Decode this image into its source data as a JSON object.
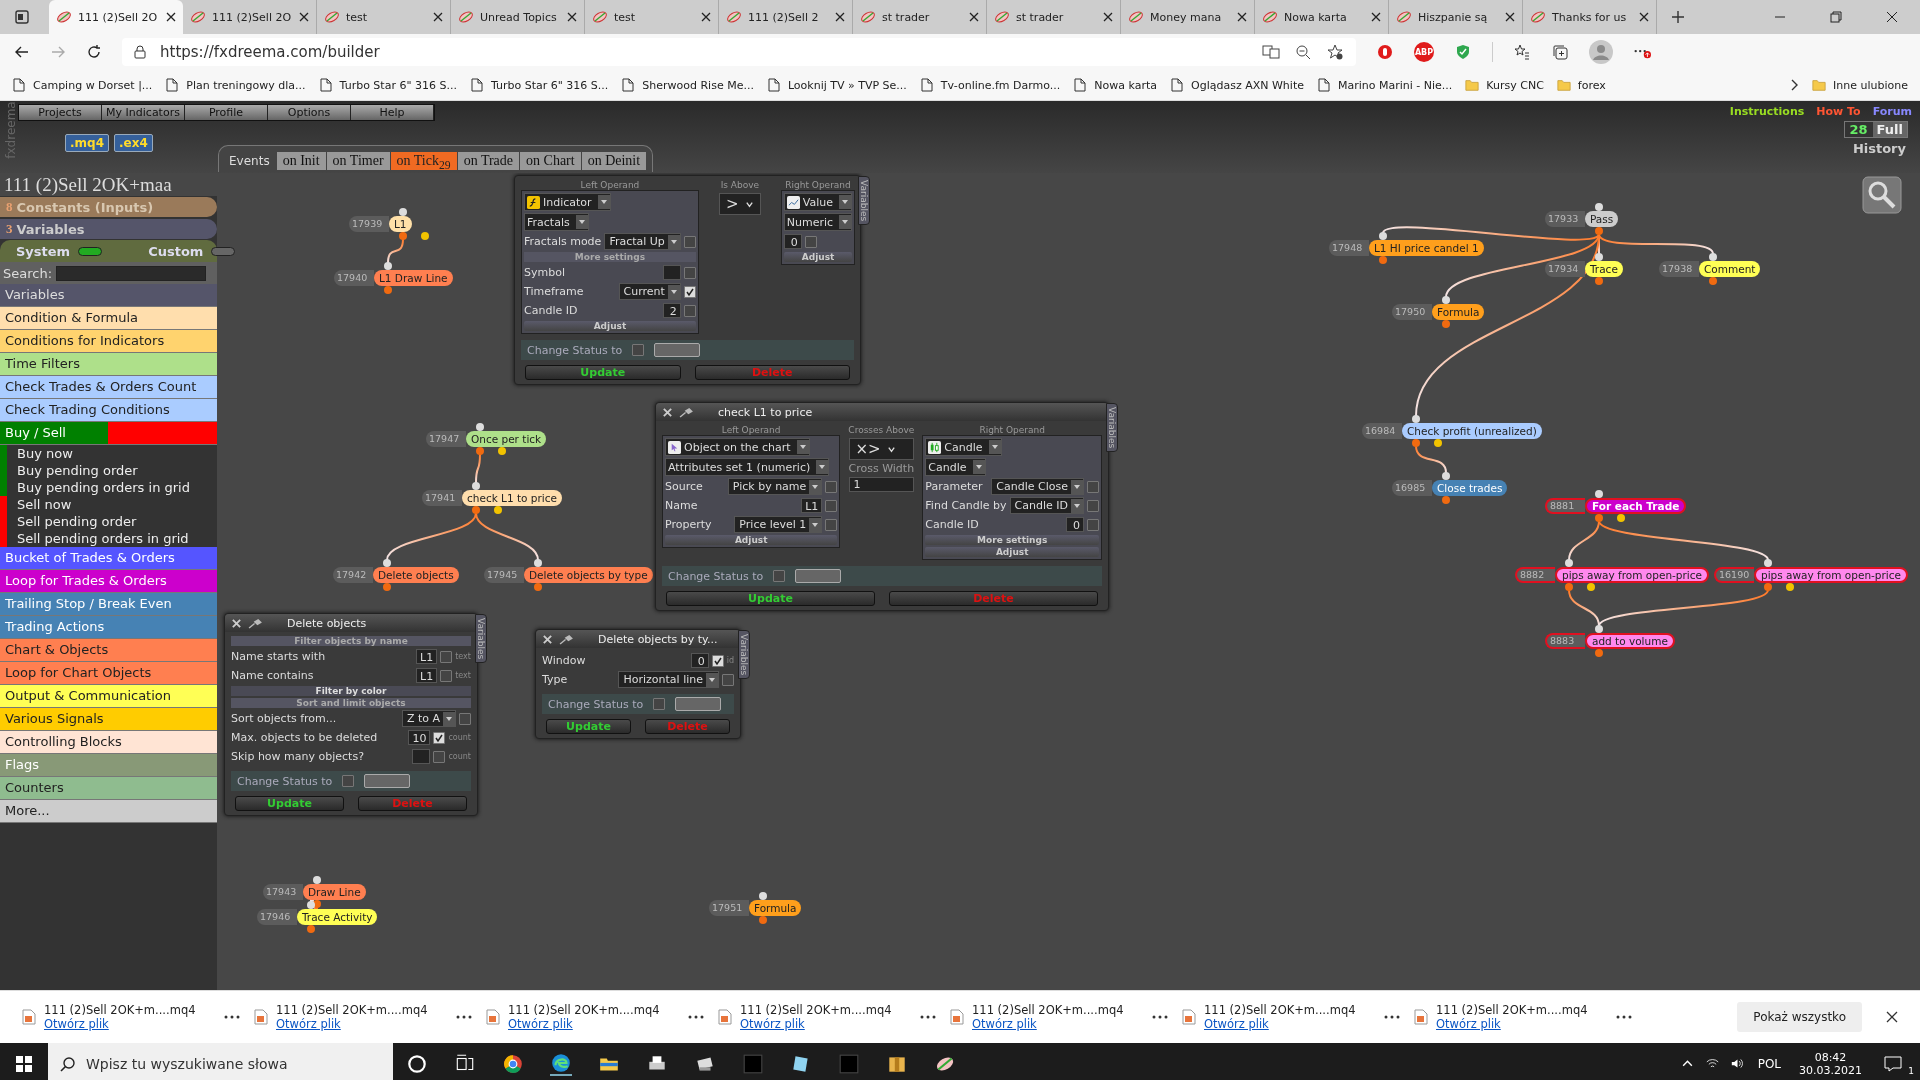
{
  "browser": {
    "tabs": [
      {
        "title": "111 (2)Sell 2O",
        "selected": true
      },
      {
        "title": "111 (2)Sell 2O",
        "selected": false
      },
      {
        "title": "test",
        "selected": false
      },
      {
        "title": "Unread Topics",
        "selected": false
      },
      {
        "title": "test",
        "selected": false
      },
      {
        "title": "111 (2)Sell 2",
        "selected": false
      },
      {
        "title": "st trader",
        "selected": false
      },
      {
        "title": "st trader",
        "selected": false
      },
      {
        "title": "Money mana",
        "selected": false
      },
      {
        "title": "Nowa karta",
        "selected": false
      },
      {
        "title": "Hiszpanie są",
        "selected": false
      },
      {
        "title": "Thanks for us",
        "selected": false
      }
    ],
    "address": "https://fxdreema.com/builder",
    "adblock_label": "ABP",
    "bookmarks": [
      {
        "label": "Camping w Dorset |...",
        "kind": "page"
      },
      {
        "label": "Plan treningowy dla...",
        "kind": "page"
      },
      {
        "label": "Turbo Star 6\" 316 S...",
        "kind": "page"
      },
      {
        "label": "Turbo Star 6\" 316 S...",
        "kind": "page"
      },
      {
        "label": "Sherwood Rise Me...",
        "kind": "page"
      },
      {
        "label": "Looknij TV » TVP Se...",
        "kind": "page"
      },
      {
        "label": "Tv-online.fm Darmo...",
        "kind": "page"
      },
      {
        "label": "Nowa karta",
        "kind": "page"
      },
      {
        "label": "Oglądasz AXN White",
        "kind": "page"
      },
      {
        "label": "Marino Marini - Nie...",
        "kind": "page"
      },
      {
        "label": "Kursy CNC",
        "kind": "folder"
      },
      {
        "label": "forex",
        "kind": "folder"
      }
    ],
    "other_bookmarks": "Inne ulubione"
  },
  "app": {
    "side_logo": "fxdreema",
    "menu": [
      "Projects",
      "My Indicators",
      "Profile",
      "Options",
      "Help"
    ],
    "exports": [
      ".mq4",
      ".ex4"
    ],
    "events_label": "Events",
    "event_tabs": [
      {
        "label": "on Init",
        "selected": false
      },
      {
        "label": "on Timer",
        "selected": false
      },
      {
        "label": "on Tick$_{29}$",
        "selected": true
      },
      {
        "label": "on Trade",
        "selected": false
      },
      {
        "label": "on Chart",
        "selected": false
      },
      {
        "label": "on Deinit",
        "selected": false
      }
    ],
    "help_links": [
      {
        "label": "Instructions",
        "color": "#99dd22"
      },
      {
        "label": "How To",
        "color": "#ff5533"
      },
      {
        "label": "Forum",
        "color": "#8888ff"
      }
    ],
    "counter": "28",
    "mode": "Full",
    "history": "History",
    "project_title": "111 (2)Sell 2OK+maa",
    "constants": {
      "count": "8",
      "label": "Constants (Inputs)"
    },
    "variables": {
      "count": "3",
      "label": "Variables"
    },
    "toggles": [
      {
        "label": "System",
        "on": true
      },
      {
        "label": "Custom",
        "on": false
      }
    ],
    "search_label": "Search:",
    "categories": [
      {
        "label": "Variables",
        "kind": "header",
        "color": "#55556a"
      },
      {
        "label": "Condition & Formula",
        "kind": "item",
        "color": "#ffdead"
      },
      {
        "label": "Conditions for Indicators",
        "kind": "item",
        "color": "#ffd36e"
      },
      {
        "label": "Time Filters",
        "kind": "item",
        "color": "#aee08a"
      },
      {
        "label": "Check Trades & Orders Count",
        "kind": "item",
        "color": "#aaccff"
      },
      {
        "label": "Check Trading Conditions",
        "kind": "item",
        "color": "#aaccff"
      },
      {
        "label": "Buy / Sell",
        "kind": "split",
        "color": "#008000",
        "children": [
          {
            "label": "Buy now",
            "kind": "buy"
          },
          {
            "label": "Buy pending order",
            "kind": "buy"
          },
          {
            "label": "Buy pending orders in grid",
            "kind": "buy"
          },
          {
            "label": "Sell now",
            "kind": "sell"
          },
          {
            "label": "Sell pending order",
            "kind": "sell"
          },
          {
            "label": "Sell pending orders in grid",
            "kind": "sell"
          }
        ]
      },
      {
        "label": "Bucket of Trades & Orders",
        "kind": "item",
        "color": "#5555ff"
      },
      {
        "label": "Loop for Trades & Orders",
        "kind": "item",
        "color": "#cc00cc"
      },
      {
        "label": "Trailing Stop / Break Even",
        "kind": "item",
        "color": "#4682b4"
      },
      {
        "label": "Trading Actions",
        "kind": "item",
        "color": "#4682b4"
      },
      {
        "label": "Chart & Objects",
        "kind": "item",
        "color": "#ff7f50"
      },
      {
        "label": "Loop for Chart Objects",
        "kind": "item",
        "color": "#ff7f50"
      },
      {
        "label": "Output & Communication",
        "kind": "item",
        "color": "#ffff55"
      },
      {
        "label": "Various Signals",
        "kind": "item",
        "color": "#ffcc00"
      },
      {
        "label": "Controlling Blocks",
        "kind": "item",
        "color": "#ffe4d4"
      },
      {
        "label": "Flags",
        "kind": "item",
        "color": "#889977"
      },
      {
        "label": "Counters",
        "kind": "item",
        "color": "#8fbc8f"
      },
      {
        "label": "More...",
        "kind": "item",
        "color": "#cccccc"
      }
    ]
  },
  "canvas": {
    "nodes": [
      {
        "id": "17939",
        "label": "L1",
        "color": "#ffe0a8",
        "selected": false,
        "false_output": true,
        "children": [
          {
            "id": "17940",
            "label": "L1 Draw Line",
            "color": "#ff7f50",
            "selected": false,
            "false_output": false
          }
        ]
      },
      {
        "id": "17947",
        "label": "Once per tick",
        "color": "#aee08a",
        "selected": false,
        "false_output": true,
        "children": [
          {
            "id": "17941",
            "label": "check L1 to price",
            "color": "#ffdead",
            "selected": false,
            "false_output": true,
            "children": [
              {
                "id": "17942",
                "label": "Delete objects",
                "color": "#ff7f50",
                "selected": false,
                "false_output": false
              },
              {
                "id": "17945",
                "label": "Delete objects by type",
                "color": "#ff7f50",
                "selected": false,
                "false_output": false
              }
            ]
          }
        ]
      },
      {
        "id": "17943",
        "label": "Draw Line",
        "color": "#ff7f50",
        "selected": false,
        "false_output": false,
        "children": [
          {
            "id": "17946",
            "label": "Trace Activity",
            "color": "#ffff55",
            "selected": false,
            "false_output": false
          }
        ]
      },
      {
        "id": "17951",
        "label": "Formula",
        "color": "#ff9f1c",
        "selected": false,
        "false_output": false
      },
      {
        "id": "17933",
        "label": "Pass",
        "color": "#cccccc",
        "selected": false,
        "false_output": false,
        "children": [
          {
            "id": "17948",
            "label": "L1 HI price candel 1",
            "color": "#ff9f1c",
            "selected": false,
            "false_output": false
          },
          {
            "id": "17950",
            "label": "Formula",
            "color": "#ff9f1c",
            "selected": false,
            "false_output": false
          },
          {
            "id": "17934",
            "label": "Trace",
            "color": "#ffff55",
            "selected": false,
            "false_output": false
          },
          {
            "id": "17938",
            "label": "Comment",
            "color": "#ffff55",
            "selected": false,
            "false_output": false
          },
          {
            "id": "16984",
            "label": "Check profit (unrealized)",
            "color": "#aaccff",
            "selected": false,
            "false_output": true,
            "children": [
              {
                "id": "16985",
                "label": "Close trades",
                "color": "#4682b4",
                "selected": false,
                "false_output": false
              }
            ]
          }
        ]
      },
      {
        "id": "8881",
        "label": "For each Trade",
        "color": "#cc00cc",
        "selected": true,
        "false_output": true,
        "children": [
          {
            "id": "8882",
            "label": "pips away from open-price",
            "color": "#ff88ee",
            "selected": true,
            "false_output": true,
            "children": [
              {
                "id": "8883",
                "label": "add to volume",
                "color": "#ff88ee",
                "selected": true,
                "false_output": false
              }
            ]
          },
          {
            "id": "16190",
            "label": "pips away from open-price",
            "color": "#ff88ee",
            "selected": true,
            "false_output": true
          }
        ]
      }
    ],
    "panels": [
      {
        "columns": [
          {
            "heading": "Left Operand",
            "rows": [
              {
                "kind": "select",
                "value": "Indicator",
                "icon": true
              },
              {
                "kind": "select",
                "value": "Fractals"
              },
              {
                "kind": "field",
                "label": "Fractals mode",
                "value": "Fractal Up",
                "dropdown": true,
                "checked": false
              },
              {
                "kind": "subheading",
                "text": "More settings"
              },
              {
                "kind": "field",
                "label": "Symbol",
                "checked": false
              },
              {
                "kind": "field",
                "label": "Timeframe",
                "value": "Current",
                "dropdown": true,
                "checked": true
              },
              {
                "kind": "field",
                "label": "Candle ID",
                "value": "2",
                "checked": false
              },
              {
                "kind": "button",
                "text": "Adjust"
              }
            ]
          },
          {
            "heading": "Is Above",
            "rows": [
              {
                "kind": "operator",
                "value": ">"
              }
            ]
          },
          {
            "heading": "Right Operand",
            "rows": [
              {
                "kind": "select",
                "value": "Value",
                "icon": true
              },
              {
                "kind": "select",
                "value": "Numeric"
              },
              {
                "kind": "field",
                "value": "0",
                "checked": false
              },
              {
                "kind": "button",
                "text": "Adjust"
              }
            ]
          }
        ],
        "status_label": "Change Status to",
        "status_checked": false,
        "update": "Update",
        "delete": "Delete",
        "side_tab": "Variables"
      },
      {
        "title": "check L1 to price",
        "columns": [
          {
            "heading": "Left Operand",
            "rows": [
              {
                "kind": "select",
                "value": "Object on the chart",
                "icon": true
              },
              {
                "kind": "select",
                "value": "Attributes set 1 (numeric)"
              },
              {
                "kind": "field",
                "label": "Source",
                "value": "Pick by name",
                "dropdown": true,
                "checked": false
              },
              {
                "kind": "field",
                "label": "Name",
                "value": "L1",
                "checked": false
              },
              {
                "kind": "field",
                "label": "Property",
                "value": "Price level 1",
                "dropdown": true,
                "checked": false
              },
              {
                "kind": "button",
                "text": "Adjust"
              }
            ]
          },
          {
            "heading": "Crosses Above",
            "rows": [
              {
                "kind": "operator",
                "value": "×>"
              },
              {
                "kind": "caption",
                "text": "Cross Width"
              },
              {
                "kind": "number",
                "value": "1"
              }
            ]
          },
          {
            "heading": "Right Operand",
            "rows": [
              {
                "kind": "select",
                "value": "Candle",
                "icon": true
              },
              {
                "kind": "select",
                "value": "Candle"
              },
              {
                "kind": "field",
                "label": "Parameter",
                "value": "Candle Close",
                "dropdown": true,
                "checked": false
              },
              {
                "kind": "field",
                "label": "Find Candle by",
                "value": "Candle ID",
                "dropdown": true,
                "checked": false
              },
              {
                "kind": "field",
                "label": "Candle ID",
                "value": "0",
                "checked": false
              },
              {
                "kind": "button",
                "text": "More settings"
              },
              {
                "kind": "button",
                "text": "Adjust"
              }
            ]
          }
        ],
        "status_label": "Change Status to",
        "status_checked": false,
        "update": "Update",
        "delete": "Delete",
        "side_tab": "Variables"
      },
      {
        "title": "Delete objects",
        "columns": [
          {
            "rows": [
              {
                "kind": "subheading",
                "text": "Filter objects by name"
              },
              {
                "kind": "field",
                "label": "Name starts with",
                "value": "L1",
                "checked": false,
                "suffix": "text"
              },
              {
                "kind": "field",
                "label": "Name contains",
                "value": "L1",
                "checked": false,
                "suffix": "text"
              },
              {
                "kind": "subheading",
                "text": "Filter by color",
                "strong": true
              },
              {
                "kind": "subheading",
                "text": "Sort and limit objects"
              },
              {
                "kind": "field",
                "label": "Sort objects from...",
                "value": "Z to A",
                "dropdown": true,
                "checked": false
              },
              {
                "kind": "field",
                "label": "Max. objects to be deleted",
                "value": "10",
                "checked": true,
                "suffix": "count"
              },
              {
                "kind": "field",
                "label": "Skip how many objects?",
                "checked": false,
                "suffix": "count"
              }
            ]
          }
        ],
        "status_label": "Change Status to",
        "status_checked": false,
        "update": "Update",
        "delete": "Delete",
        "side_tab": "Variables"
      },
      {
        "title": "Delete objects by ty...",
        "columns": [
          {
            "rows": [
              {
                "kind": "field",
                "label": "Window",
                "value": "0",
                "checked": true,
                "suffix": "id"
              },
              {
                "kind": "field",
                "label": "Type",
                "value": "Horizontal line",
                "dropdown": true,
                "checked": false
              }
            ]
          }
        ],
        "status_label": "Change Status to",
        "status_checked": false,
        "update": "Update",
        "delete": "Delete",
        "side_tab": "Variables"
      }
    ]
  },
  "downloads": {
    "items": [
      {
        "name": "111 (2)Sell 2OK+m....mq4",
        "action": "Otwórz plik"
      },
      {
        "name": "111 (2)Sell 2OK+m....mq4",
        "action": "Otwórz plik"
      },
      {
        "name": "111 (2)Sell 2OK+m....mq4",
        "action": "Otwórz plik"
      },
      {
        "name": "111 (2)Sell 2OK+m....mq4",
        "action": "Otwórz plik"
      },
      {
        "name": "111 (2)Sell 2OK+m....mq4",
        "action": "Otwórz plik"
      },
      {
        "name": "111 (2)Sell 2OK+m....mq4",
        "action": "Otwórz plik"
      },
      {
        "name": "111 (2)Sell 2OK+m....mq4",
        "action": "Otwórz plik"
      }
    ],
    "show_all": "Pokaż wszystko"
  },
  "taskbar": {
    "search_placeholder": "Wpisz tu wyszukiwane słowa",
    "language": "POL",
    "time": "08:42",
    "date": "30.03.2021",
    "notifications": "1"
  }
}
